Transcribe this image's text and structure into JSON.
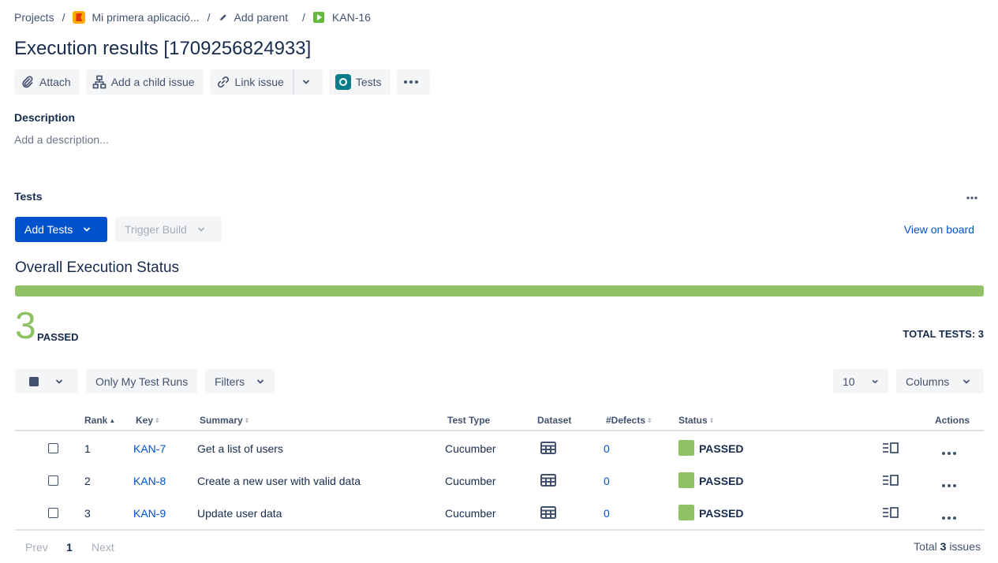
{
  "breadcrumb": {
    "projects": "Projects",
    "project": "Mi primera aplicació...",
    "add_parent": "Add parent",
    "issue_key": "KAN-16",
    "separator": "/"
  },
  "title": "Execution results [1709256824933]",
  "actions": {
    "attach": "Attach",
    "add_child": "Add a child issue",
    "link_issue": "Link issue",
    "tests": "Tests"
  },
  "description": {
    "label": "Description",
    "placeholder": "Add a description..."
  },
  "tests_panel": {
    "label": "Tests",
    "add_tests": "Add Tests",
    "trigger_build": "Trigger Build",
    "view_on_board": "View on board",
    "overall_title": "Overall Execution Status",
    "passed_fraction": 1.0,
    "passed_count": "3",
    "passed_label": "PASSED",
    "total_tests": "TOTAL TESTS: 3",
    "status_color": "#8fc165"
  },
  "toolbar": {
    "only_my_runs": "Only My Test Runs",
    "filters": "Filters",
    "page_size": "10",
    "columns": "Columns"
  },
  "table": {
    "headers": {
      "rank": "Rank",
      "key": "Key",
      "summary": "Summary",
      "test_type": "Test Type",
      "dataset": "Dataset",
      "defects": "#Defects",
      "status": "Status",
      "actions": "Actions"
    },
    "rows": [
      {
        "rank": "1",
        "key": "KAN-7",
        "summary": "Get a list of users",
        "test_type": "Cucumber",
        "defects": "0",
        "status": "PASSED"
      },
      {
        "rank": "2",
        "key": "KAN-8",
        "summary": "Create a new user with valid data",
        "test_type": "Cucumber",
        "defects": "0",
        "status": "PASSED"
      },
      {
        "rank": "3",
        "key": "KAN-9",
        "summary": "Update user data",
        "test_type": "Cucumber",
        "defects": "0",
        "status": "PASSED"
      }
    ]
  },
  "pagination": {
    "prev": "Prev",
    "current": "1",
    "next": "Next",
    "total_prefix": "Total",
    "total_count": "3",
    "total_suffix": "issues"
  }
}
